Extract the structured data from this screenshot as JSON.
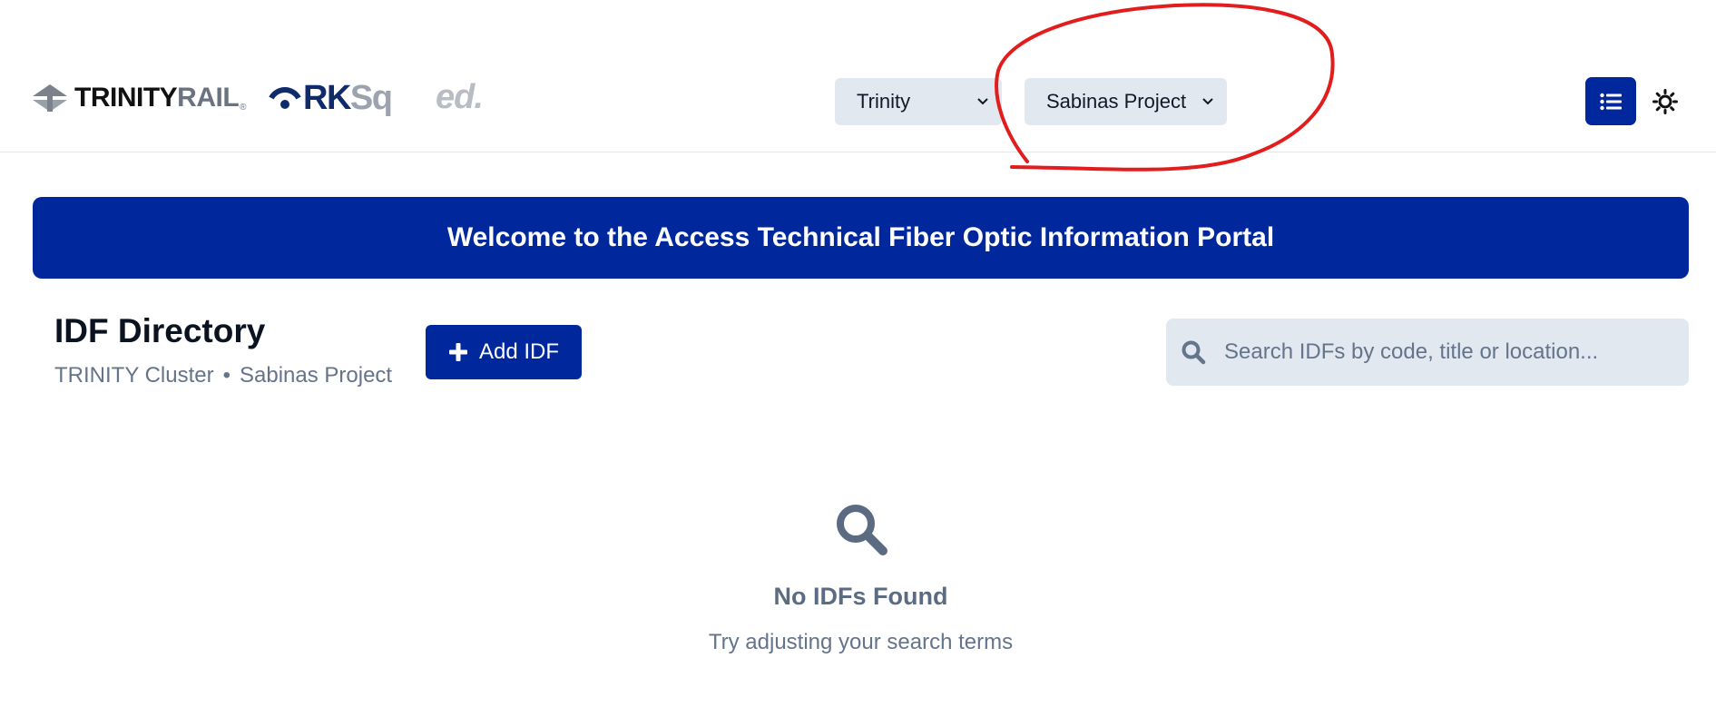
{
  "header": {
    "logos": {
      "trinity": {
        "part1": "TRINITY",
        "part2": "RAIL",
        "registered": "®"
      },
      "rksq": {
        "part1": "RK",
        "part2": "Sq"
      },
      "ed": {
        "text": "ed."
      }
    },
    "cluster_select": {
      "value": "Trinity"
    },
    "project_select": {
      "value": "Sabinas Project"
    },
    "list_view_icon": "list-icon",
    "theme_icon": "sun-icon"
  },
  "banner": {
    "text": "Welcome to the Access Technical Fiber Optic Information Portal"
  },
  "directory": {
    "title": "IDF Directory",
    "cluster": "TRINITY Cluster",
    "separator": "•",
    "project": "Sabinas Project",
    "add_button": "Add IDF",
    "search_placeholder": "Search IDFs by code, title or location..."
  },
  "empty_state": {
    "icon": "search-icon",
    "title": "No IDFs Found",
    "subtitle": "Try adjusting your search terms"
  },
  "colors": {
    "primary": "#00279b",
    "field_bg": "#e2e8f0",
    "muted_text": "#64748b",
    "annotation": "#e11d1d"
  }
}
